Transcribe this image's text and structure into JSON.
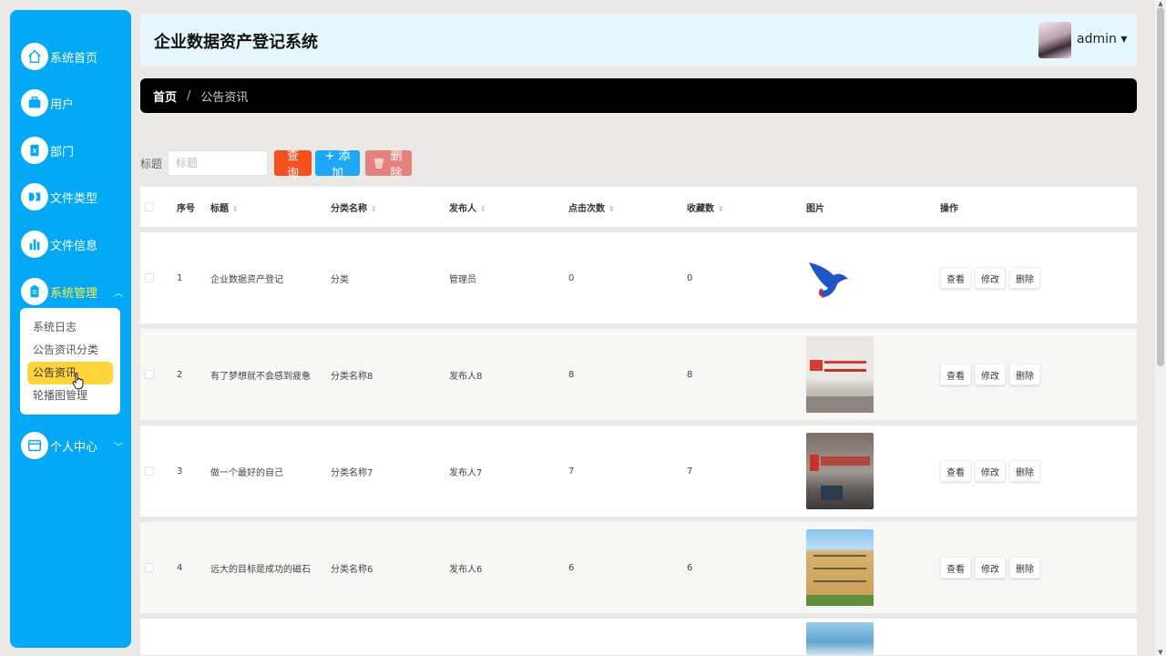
{
  "sidebar": {
    "items": [
      {
        "label": "系统首页",
        "icon": "home-icon"
      },
      {
        "label": "用户",
        "icon": "briefcase-icon"
      },
      {
        "label": "部门",
        "icon": "document-icon"
      },
      {
        "label": "文件类型",
        "icon": "folder-icon"
      },
      {
        "label": "文件信息",
        "icon": "bar-chart-icon"
      },
      {
        "label": "系统管理",
        "icon": "clipboard-icon"
      },
      {
        "label": "个人中心",
        "icon": "window-icon"
      }
    ],
    "submenu": [
      "系统日志",
      "公告资讯分类",
      "公告资讯",
      "轮播图管理"
    ],
    "active_item": "系统管理",
    "active_sub": "公告资讯"
  },
  "header": {
    "title": "企业数据资产登记系统",
    "user": "admin ▾"
  },
  "breadcrumb": {
    "home": "首页",
    "sep": "/",
    "current": "公告资讯"
  },
  "search": {
    "label": "标题",
    "placeholder": "标题",
    "query_btn": "查询",
    "add_btn": "+ 添加",
    "delete_btn": "删除"
  },
  "table": {
    "headers": [
      "序号",
      "标题",
      "分类名称",
      "发布人",
      "点击次数",
      "收藏数",
      "图片",
      "操作"
    ],
    "rows": [
      {
        "no": "1",
        "title": "企业数据资产登记",
        "category": "分类",
        "publisher": "管理员",
        "clicks": "0",
        "favs": "0"
      },
      {
        "no": "2",
        "title": "有了梦想就不会感到疲惫",
        "category": "分类名称8",
        "publisher": "发布人8",
        "clicks": "8",
        "favs": "8"
      },
      {
        "no": "3",
        "title": "做一个最好的自己",
        "category": "分类名称7",
        "publisher": "发布人7",
        "clicks": "7",
        "favs": "7"
      },
      {
        "no": "4",
        "title": "远大的目标是成功的磁石",
        "category": "分类名称6",
        "publisher": "发布人6",
        "clicks": "6",
        "favs": "6"
      }
    ],
    "actions": {
      "view": "查看",
      "edit": "修改",
      "delete": "删除"
    }
  },
  "colors": {
    "sidebar": "#03a9f4",
    "active": "#ffeb3b",
    "query": "#f4511e",
    "add": "#1ea7f4",
    "delete": "#e5827f"
  }
}
